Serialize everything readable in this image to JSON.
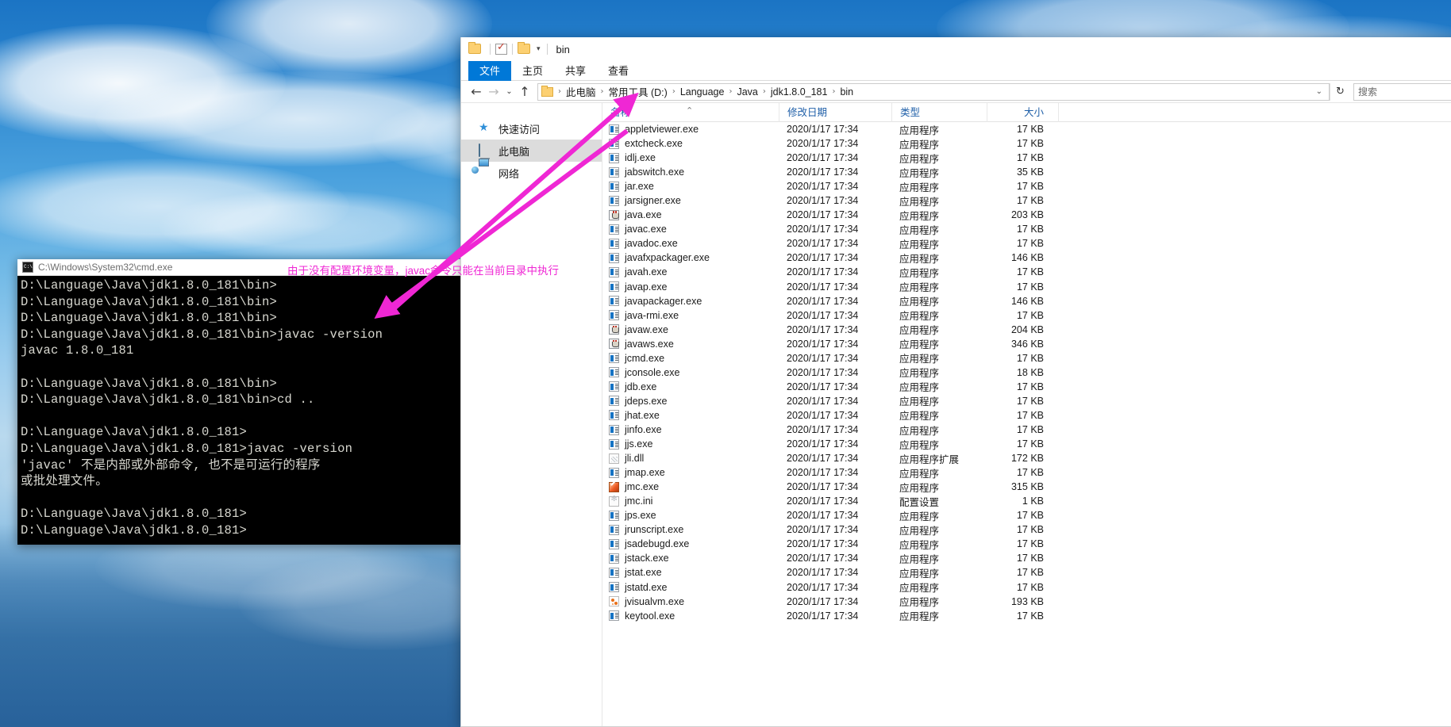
{
  "desktop": {
    "name": "desktop-wallpaper"
  },
  "cmd": {
    "title": "C:\\Windows\\System32\\cmd.exe",
    "icon": "cmd-icon",
    "lines": [
      "D:\\Language\\Java\\jdk1.8.0_181\\bin>",
      "D:\\Language\\Java\\jdk1.8.0_181\\bin>",
      "D:\\Language\\Java\\jdk1.8.0_181\\bin>",
      "D:\\Language\\Java\\jdk1.8.0_181\\bin>javac -version",
      "javac 1.8.0_181",
      "",
      "D:\\Language\\Java\\jdk1.8.0_181\\bin>",
      "D:\\Language\\Java\\jdk1.8.0_181\\bin>cd ..",
      "",
      "D:\\Language\\Java\\jdk1.8.0_181>",
      "D:\\Language\\Java\\jdk1.8.0_181>javac -version",
      "'javac' 不是内部或外部命令, 也不是可运行的程序",
      "或批处理文件。",
      "",
      "D:\\Language\\Java\\jdk1.8.0_181>",
      "D:\\Language\\Java\\jdk1.8.0_181>"
    ]
  },
  "annotation": {
    "text": "由于没有配置环境变量，javac命令只能在当前目录中执行",
    "color": "#ef27d4"
  },
  "explorer": {
    "title": "bin",
    "quick_access_icons": [
      "folder-icon",
      "properties-check-icon",
      "new-folder-icon",
      "chevron-down-icon"
    ],
    "window_controls": [
      {
        "name": "minimize-button",
        "glyph": "—"
      }
    ],
    "tabs": [
      {
        "label": "文件",
        "active": true
      },
      {
        "label": "主页",
        "active": false
      },
      {
        "label": "共享",
        "active": false
      },
      {
        "label": "查看",
        "active": false
      }
    ],
    "nav_buttons": [
      {
        "name": "back-button",
        "glyph": "←",
        "enabled": true
      },
      {
        "name": "forward-button",
        "glyph": "→",
        "enabled": false
      },
      {
        "name": "recent-locations-button",
        "glyph": "⌄",
        "enabled": true
      },
      {
        "name": "up-button",
        "glyph": "↑",
        "enabled": true
      }
    ],
    "breadcrumb": [
      "此电脑",
      "常用工具 (D:)",
      "Language",
      "Java",
      "jdk1.8.0_181",
      "bin"
    ],
    "address_caret": "⌄",
    "refresh_icon": "↻",
    "search_placeholder": "搜索",
    "sidebar": [
      {
        "label": "快速访问",
        "icon": "star-icon",
        "selected": false
      },
      {
        "label": "此电脑",
        "icon": "this-pc-icon",
        "selected": true
      },
      {
        "label": "网络",
        "icon": "network-icon",
        "selected": false
      }
    ],
    "columns": [
      {
        "label": "名称",
        "key": "name",
        "sorted": true
      },
      {
        "label": "修改日期",
        "key": "date"
      },
      {
        "label": "类型",
        "key": "type"
      },
      {
        "label": "大小",
        "key": "size"
      }
    ],
    "sort_caret": "⌃",
    "files": [
      {
        "name": "appletviewer.exe",
        "date": "2020/1/17 17:34",
        "type": "应用程序",
        "size": "17 KB",
        "icon": "exe"
      },
      {
        "name": "extcheck.exe",
        "date": "2020/1/17 17:34",
        "type": "应用程序",
        "size": "17 KB",
        "icon": "exe"
      },
      {
        "name": "idlj.exe",
        "date": "2020/1/17 17:34",
        "type": "应用程序",
        "size": "17 KB",
        "icon": "exe"
      },
      {
        "name": "jabswitch.exe",
        "date": "2020/1/17 17:34",
        "type": "应用程序",
        "size": "35 KB",
        "icon": "exe"
      },
      {
        "name": "jar.exe",
        "date": "2020/1/17 17:34",
        "type": "应用程序",
        "size": "17 KB",
        "icon": "exe"
      },
      {
        "name": "jarsigner.exe",
        "date": "2020/1/17 17:34",
        "type": "应用程序",
        "size": "17 KB",
        "icon": "exe"
      },
      {
        "name": "java.exe",
        "date": "2020/1/17 17:34",
        "type": "应用程序",
        "size": "203 KB",
        "icon": "java"
      },
      {
        "name": "javac.exe",
        "date": "2020/1/17 17:34",
        "type": "应用程序",
        "size": "17 KB",
        "icon": "exe"
      },
      {
        "name": "javadoc.exe",
        "date": "2020/1/17 17:34",
        "type": "应用程序",
        "size": "17 KB",
        "icon": "exe"
      },
      {
        "name": "javafxpackager.exe",
        "date": "2020/1/17 17:34",
        "type": "应用程序",
        "size": "146 KB",
        "icon": "exe"
      },
      {
        "name": "javah.exe",
        "date": "2020/1/17 17:34",
        "type": "应用程序",
        "size": "17 KB",
        "icon": "exe"
      },
      {
        "name": "javap.exe",
        "date": "2020/1/17 17:34",
        "type": "应用程序",
        "size": "17 KB",
        "icon": "exe"
      },
      {
        "name": "javapackager.exe",
        "date": "2020/1/17 17:34",
        "type": "应用程序",
        "size": "146 KB",
        "icon": "exe"
      },
      {
        "name": "java-rmi.exe",
        "date": "2020/1/17 17:34",
        "type": "应用程序",
        "size": "17 KB",
        "icon": "exe"
      },
      {
        "name": "javaw.exe",
        "date": "2020/1/17 17:34",
        "type": "应用程序",
        "size": "204 KB",
        "icon": "java"
      },
      {
        "name": "javaws.exe",
        "date": "2020/1/17 17:34",
        "type": "应用程序",
        "size": "346 KB",
        "icon": "java"
      },
      {
        "name": "jcmd.exe",
        "date": "2020/1/17 17:34",
        "type": "应用程序",
        "size": "17 KB",
        "icon": "exe"
      },
      {
        "name": "jconsole.exe",
        "date": "2020/1/17 17:34",
        "type": "应用程序",
        "size": "18 KB",
        "icon": "exe"
      },
      {
        "name": "jdb.exe",
        "date": "2020/1/17 17:34",
        "type": "应用程序",
        "size": "17 KB",
        "icon": "exe"
      },
      {
        "name": "jdeps.exe",
        "date": "2020/1/17 17:34",
        "type": "应用程序",
        "size": "17 KB",
        "icon": "exe"
      },
      {
        "name": "jhat.exe",
        "date": "2020/1/17 17:34",
        "type": "应用程序",
        "size": "17 KB",
        "icon": "exe"
      },
      {
        "name": "jinfo.exe",
        "date": "2020/1/17 17:34",
        "type": "应用程序",
        "size": "17 KB",
        "icon": "exe"
      },
      {
        "name": "jjs.exe",
        "date": "2020/1/17 17:34",
        "type": "应用程序",
        "size": "17 KB",
        "icon": "exe"
      },
      {
        "name": "jli.dll",
        "date": "2020/1/17 17:34",
        "type": "应用程序扩展",
        "size": "172 KB",
        "icon": "dll"
      },
      {
        "name": "jmap.exe",
        "date": "2020/1/17 17:34",
        "type": "应用程序",
        "size": "17 KB",
        "icon": "exe"
      },
      {
        "name": "jmc.exe",
        "date": "2020/1/17 17:34",
        "type": "应用程序",
        "size": "315 KB",
        "icon": "jmc"
      },
      {
        "name": "jmc.ini",
        "date": "2020/1/17 17:34",
        "type": "配置设置",
        "size": "1 KB",
        "icon": "ini"
      },
      {
        "name": "jps.exe",
        "date": "2020/1/17 17:34",
        "type": "应用程序",
        "size": "17 KB",
        "icon": "exe"
      },
      {
        "name": "jrunscript.exe",
        "date": "2020/1/17 17:34",
        "type": "应用程序",
        "size": "17 KB",
        "icon": "exe"
      },
      {
        "name": "jsadebugd.exe",
        "date": "2020/1/17 17:34",
        "type": "应用程序",
        "size": "17 KB",
        "icon": "exe"
      },
      {
        "name": "jstack.exe",
        "date": "2020/1/17 17:34",
        "type": "应用程序",
        "size": "17 KB",
        "icon": "exe"
      },
      {
        "name": "jstat.exe",
        "date": "2020/1/17 17:34",
        "type": "应用程序",
        "size": "17 KB",
        "icon": "exe"
      },
      {
        "name": "jstatd.exe",
        "date": "2020/1/17 17:34",
        "type": "应用程序",
        "size": "17 KB",
        "icon": "exe"
      },
      {
        "name": "jvisualvm.exe",
        "date": "2020/1/17 17:34",
        "type": "应用程序",
        "size": "193 KB",
        "icon": "jvm"
      },
      {
        "name": "keytool.exe",
        "date": "2020/1/17 17:34",
        "type": "应用程序",
        "size": "17 KB",
        "icon": "exe"
      }
    ]
  }
}
